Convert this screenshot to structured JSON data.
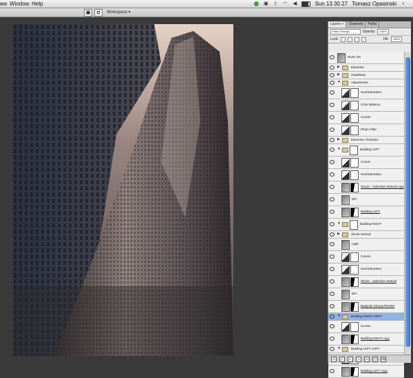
{
  "menubar": {
    "items": [
      "ew",
      "Window",
      "Help"
    ],
    "clock": "Sun 13 30 27",
    "user": "Tomasz Opasinski"
  },
  "optionsbar": {
    "workspace_label": "Workspace"
  },
  "panel": {
    "tabs": [
      "Layers ×",
      "Channels",
      "Paths"
    ],
    "blend_mode": "Pass Through",
    "opacity_label": "Opacity:",
    "opacity_value": "100%",
    "lock_label": "Lock:",
    "fill_label": "Fill:",
    "fill_value": "100%",
    "layers": [
      {
        "name": "Noise 3%",
        "kind": "layer",
        "tall": true
      },
      {
        "name": "Elements",
        "kind": "group"
      },
      {
        "name": "Guidelines",
        "kind": "group"
      },
      {
        "name": "Adjustments",
        "kind": "group-open"
      },
      {
        "name": "Hue/Saturation",
        "kind": "adj",
        "tall": true
      },
      {
        "name": "Color Balance",
        "kind": "adj",
        "tall": true
      },
      {
        "name": "Curves",
        "kind": "adj",
        "tall": true
      },
      {
        "name": "Photo Filter",
        "kind": "adj",
        "tall": true
      },
      {
        "name": "Elements / Particles",
        "kind": "group"
      },
      {
        "name": "Building LEFT",
        "kind": "group-open-mask",
        "tall": true
      },
      {
        "name": "Curves",
        "kind": "adj",
        "tall": true
      },
      {
        "name": "Hue/Saturation",
        "kind": "adj",
        "tall": true
      },
      {
        "name": "Shock – Selection Vertical copy",
        "kind": "layer-mask",
        "tall": true,
        "ul": true
      },
      {
        "name": "Dirt",
        "kind": "layer",
        "tall": true
      },
      {
        "name": "Building LEFT",
        "kind": "layer-mask",
        "tall": true,
        "ul": true
      },
      {
        "name": "Building RIGHT",
        "kind": "group-open-mask",
        "tall": true
      },
      {
        "name": "Shock Vertical",
        "kind": "group"
      },
      {
        "name": "Light",
        "kind": "layer",
        "tall": true
      },
      {
        "name": "Curves",
        "kind": "adj",
        "tall": true
      },
      {
        "name": "Hue/Saturation",
        "kind": "adj",
        "tall": true
      },
      {
        "name": "Shock – Selection Vertical",
        "kind": "layer-mask",
        "tall": true,
        "ul": true
      },
      {
        "name": "Dirt",
        "kind": "layer",
        "tall": true
      },
      {
        "name": "Budynek Strona PRAWA",
        "kind": "layer-mask",
        "tall": true,
        "ul": true
      },
      {
        "name": "Building RIGHT COPY",
        "kind": "group-open",
        "selected": true
      },
      {
        "name": "Curves",
        "kind": "adj",
        "tall": true
      },
      {
        "name": "Building RIGHT copy",
        "kind": "layer-mask",
        "tall": true,
        "ul": true
      },
      {
        "name": "Building LEFT COPY",
        "kind": "group-open"
      },
      {
        "name": "Curves",
        "kind": "adj",
        "tall": true
      },
      {
        "name": "Building LEFT copy",
        "kind": "layer-mask",
        "tall": true,
        "ul": true
      }
    ]
  }
}
